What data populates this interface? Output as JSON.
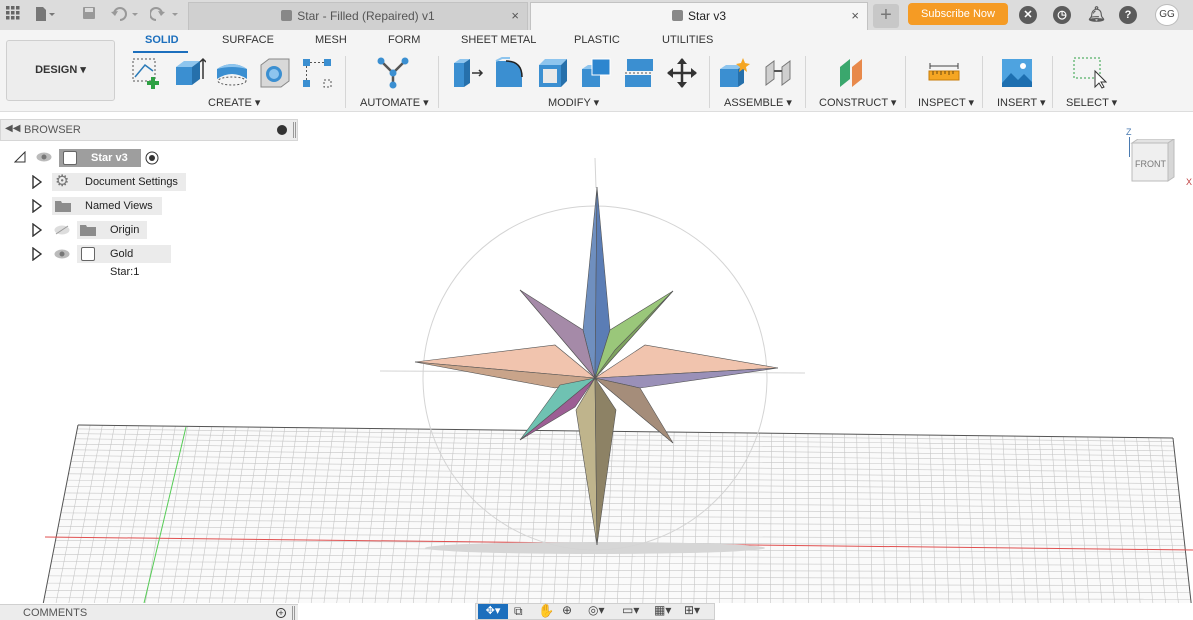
{
  "topbar": {
    "tabs": [
      {
        "label": "Star - Filled (Repaired) v1",
        "close": "×"
      },
      {
        "label": "Star v3",
        "close": "×"
      }
    ],
    "new_tab": "+",
    "subscribe": "Subscribe Now",
    "user_initials": "GG",
    "help": "?"
  },
  "toolbar": {
    "workspace": "DESIGN ▾",
    "workspace_tabs": [
      "SOLID",
      "SURFACE",
      "MESH",
      "FORM",
      "SHEET METAL",
      "PLASTIC",
      "UTILITIES"
    ],
    "groups": [
      "CREATE ▾",
      "AUTOMATE ▾",
      "MODIFY ▾",
      "ASSEMBLE ▾",
      "CONSTRUCT ▾",
      "INSPECT ▾",
      "INSERT ▾",
      "SELECT ▾"
    ]
  },
  "browser": {
    "title": "BROWSER",
    "root": "Star v3",
    "items": [
      "Document Settings",
      "Named Views",
      "Origin",
      "Gold Star:1"
    ]
  },
  "viewcube": {
    "face": "FRONT",
    "axis_z": "Z",
    "axis_x": "X"
  },
  "comments": {
    "title": "COMMENTS"
  },
  "colors": {
    "accent": "#1c6fbd",
    "subscribe": "#f59b24",
    "axis_red": "#e05050",
    "axis_green": "#55cc55"
  }
}
